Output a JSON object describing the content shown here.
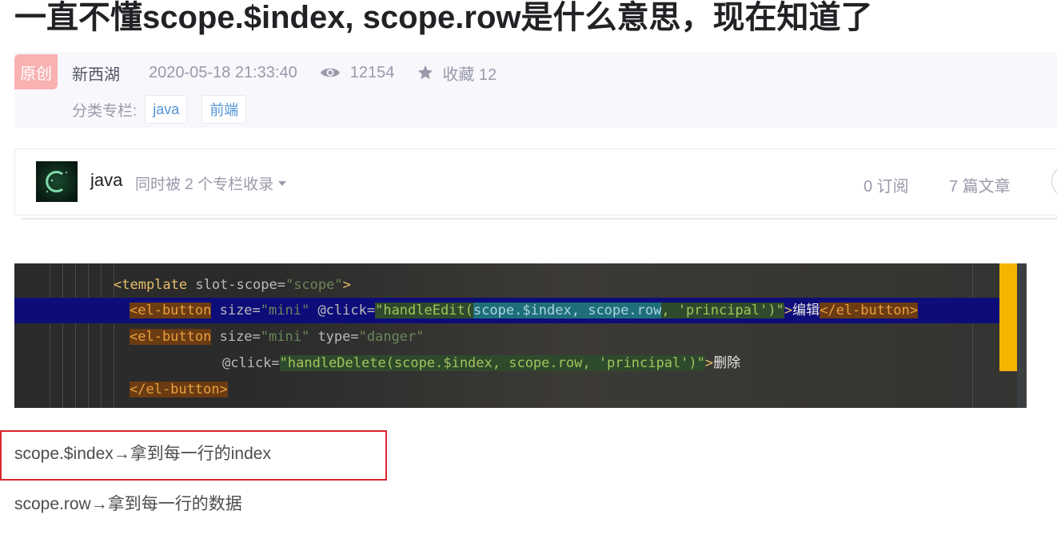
{
  "article": {
    "title": "一直不懂scope.$index, scope.row是什么意思，现在知道了",
    "badge": "原创",
    "author": "新西湖",
    "date": "2020-05-18 21:33:40",
    "views": "12154",
    "favorites": "收藏 12",
    "category_label": "分类专栏:",
    "tags": [
      "java",
      "前端"
    ]
  },
  "column": {
    "name": "java",
    "description": "同时被 2 个专栏收录",
    "subscribers": "0 订阅",
    "articles": "7 篇文章"
  },
  "code_image": {
    "line1_a": "<template",
    "line1_b": " slot-scope=",
    "line1_c": "\"scope\"",
    "line1_d": ">",
    "line2_a": "<el-button",
    "line2_b": " size=",
    "line2_c": "\"mini\"",
    "line2_d": " @click=",
    "line2_e": "\"handleEdit(",
    "line2_f": "scope.$index, scope.row",
    "line2_g": ", 'principal')\"",
    "line2_h": ">",
    "line2_i": "编辑",
    "line2_j": "</el-button>",
    "line3_a": "<el-button",
    "line3_b": " size=",
    "line3_c": "\"mini\"",
    "line3_d": " type=",
    "line3_e": "\"danger\"",
    "line4_a": "@click=",
    "line4_b": "\"handleDelete(scope.$index, scope.row, 'principal')\"",
    "line4_c": ">",
    "line4_d": "删除",
    "line5_a": "</el-button>"
  },
  "body": {
    "line1": "scope.$index→拿到每一行的index",
    "line2": "scope.row→拿到每一行的数据"
  },
  "colors": {
    "accent_link": "#5094d5",
    "badge": "#f9b1b1",
    "highlight_box": "#d9252f"
  }
}
